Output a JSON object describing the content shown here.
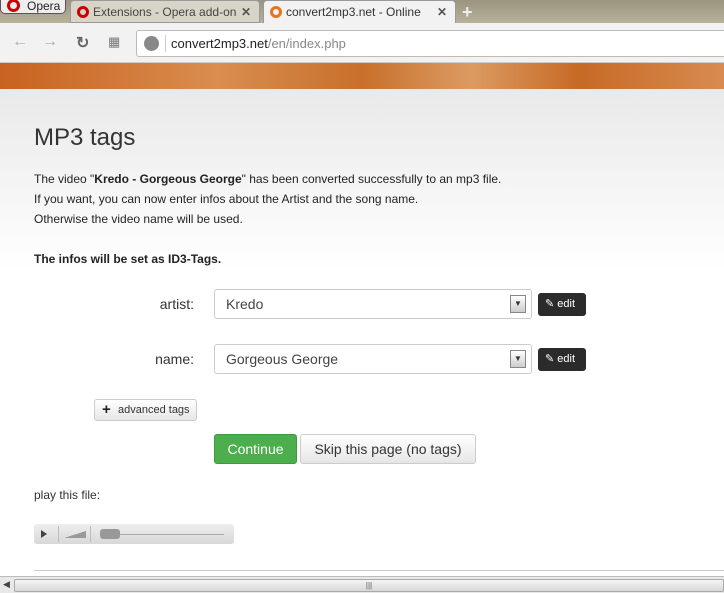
{
  "browser": {
    "opera_label": "Opera",
    "tabs": [
      {
        "title": "Extensions - Opera add-on",
        "close": "✕"
      },
      {
        "title": "convert2mp3.net - Online",
        "close": "✕"
      }
    ],
    "new_tab": "+",
    "url_host": "convert2mp3.net",
    "url_path": "/en/index.php"
  },
  "page": {
    "title": "MP3 tags",
    "intro_pre": "The video \"",
    "video_name": "Kredo - Gorgeous George",
    "intro_post": "\" has been converted successfully to an mp3 file.",
    "line2": "If you want, you can now enter infos about the Artist and the song name.",
    "line3": "Otherwise the video name will be used.",
    "id3_note": "The infos will be set as ID3-Tags.",
    "artist_label": "artist:",
    "artist_value": "Kredo",
    "name_label": "name:",
    "name_value": "Gorgeous George",
    "edit_label": "edit",
    "advanced_label": "advanced tags",
    "continue_label": "Continue",
    "skip_label": "Skip this page (no tags)",
    "play_label": "play this file:",
    "player_progress": 0
  }
}
